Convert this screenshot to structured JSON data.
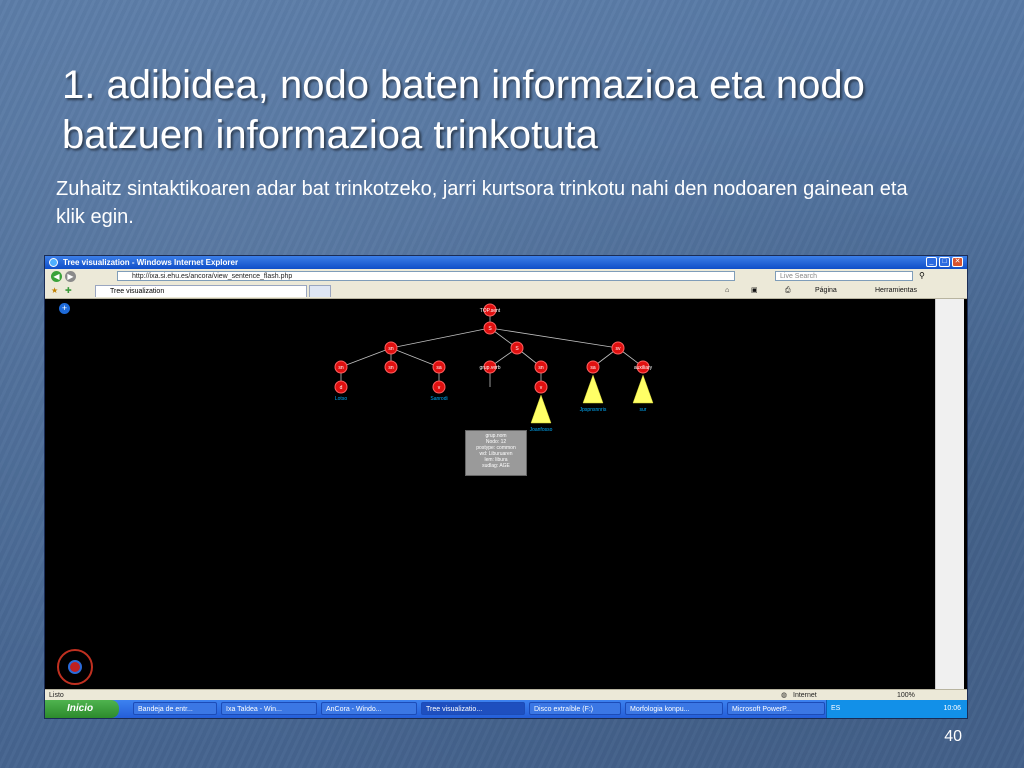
{
  "slide": {
    "title": "1. adibidea, nodo baten informazioa eta nodo batzuen informazioa trinkotuta",
    "body": "Zuhaitz sintaktikoaren adar bat trinkotzeko, jarri kurtsora trinkotu nahi den nodoaren gainean eta klik egin.",
    "page_number": "40"
  },
  "browser": {
    "window_title": "Tree visualization - Windows Internet Explorer",
    "address": "http://ixa.si.ehu.es/ancora/view_sentence_flash.php",
    "search_placeholder": "Live Search",
    "tab_label": "Tree visualization",
    "commands": [
      "Página",
      "Herramientas"
    ],
    "status_left": "Listo",
    "status_zone": "Internet",
    "zoom": "100%"
  },
  "tree": {
    "root": "TOP.sent",
    "nodes": [
      "S",
      "sn",
      "S",
      "sv",
      "sn",
      "sn",
      "sa",
      "grup.verb",
      "sn",
      "sa",
      "v",
      "auxiliary",
      "d",
      "v"
    ],
    "leaves": [
      "Lotso",
      "Sanrodi",
      "Jpspnsnnris",
      "sur",
      "Joanfosso"
    ],
    "tooltip": [
      "grup.nom",
      "Nodo: 12",
      "postype: common",
      "wd: Liburuaren",
      "lem: libura",
      "sudlag: AGE"
    ]
  },
  "taskbar": {
    "start_label": "Inicio",
    "tasks": [
      "Bandeja de entr...",
      "Ixa Taldea - Win...",
      "AnCora - Windo...",
      "Tree visualizatio...",
      "Disco extraíble (F:)",
      "Morfologia konpu...",
      "Microsoft PowerP..."
    ],
    "language": "ES",
    "clock": "10:06"
  },
  "colors": {
    "slide_bg": "#4a6a96",
    "node_fill": "#e01010",
    "leaf_text": "#00b0ff",
    "collapsed_triangle": "#ffff66"
  }
}
